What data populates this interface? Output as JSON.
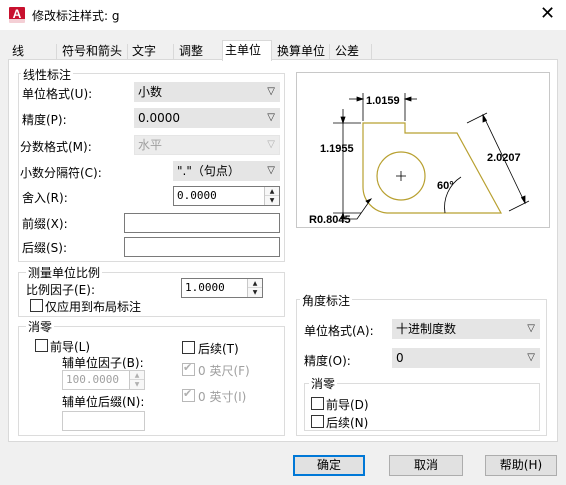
{
  "window": {
    "title": "修改标注样式: g",
    "close": "✕",
    "app_icon": "A"
  },
  "tabs": [
    {
      "label": "线",
      "selected": false
    },
    {
      "label": "符号和箭头",
      "selected": false
    },
    {
      "label": "文字",
      "selected": false
    },
    {
      "label": "调整",
      "selected": false
    },
    {
      "label": "主单位",
      "selected": true
    },
    {
      "label": "换算单位",
      "selected": false
    },
    {
      "label": "公差",
      "selected": false
    }
  ],
  "linear": {
    "group_title": "线性标注",
    "unit_format_label": "单位格式(U):",
    "unit_format_value": "小数",
    "precision_label": "精度(P):",
    "precision_value": "0.0000",
    "fraction_format_label": "分数格式(M):",
    "fraction_format_value": "水平",
    "decimal_sep_label": "小数分隔符(C):",
    "decimal_sep_value": "\".\"（句点）",
    "round_label": "舍入(R):",
    "round_value": "0.0000",
    "prefix_label": "前缀(X):",
    "prefix_value": "",
    "suffix_label": "后缀(S):",
    "suffix_value": ""
  },
  "scale": {
    "group_title": "测量单位比例",
    "factor_label": "比例因子(E):",
    "factor_value": "1.0000",
    "layout_only_label": "仅应用到布局标注"
  },
  "zero_left": {
    "group_title": "消零",
    "leading_label": "前导(L)",
    "sub_factor_label": "辅单位因子(B):",
    "sub_factor_value": "100.0000",
    "sub_suffix_label": "辅单位后缀(N):",
    "sub_suffix_value": "",
    "trailing_label": "后续(T)",
    "feet_label": "0 英尺(F)",
    "inches_label": "0 英寸(I)"
  },
  "angular": {
    "group_title": "角度标注",
    "unit_format_label": "单位格式(A):",
    "unit_format_value": "十进制度数",
    "precision_label": "精度(O):",
    "precision_value": "0",
    "zero_title": "消零",
    "leading_label": "前导(D)",
    "trailing_label": "后续(N)"
  },
  "preview": {
    "dim_top": "1.0159",
    "dim_left": "1.1955",
    "dim_right": "2.0207",
    "dim_angle": "60°",
    "dim_radius": "R0.8045",
    "line_color": "#b8a030"
  },
  "buttons": {
    "ok": "确定",
    "cancel": "取消",
    "help": "帮助(H)"
  },
  "colors": {
    "accent": "#0078d7",
    "brand_icon": "#c8102e"
  }
}
